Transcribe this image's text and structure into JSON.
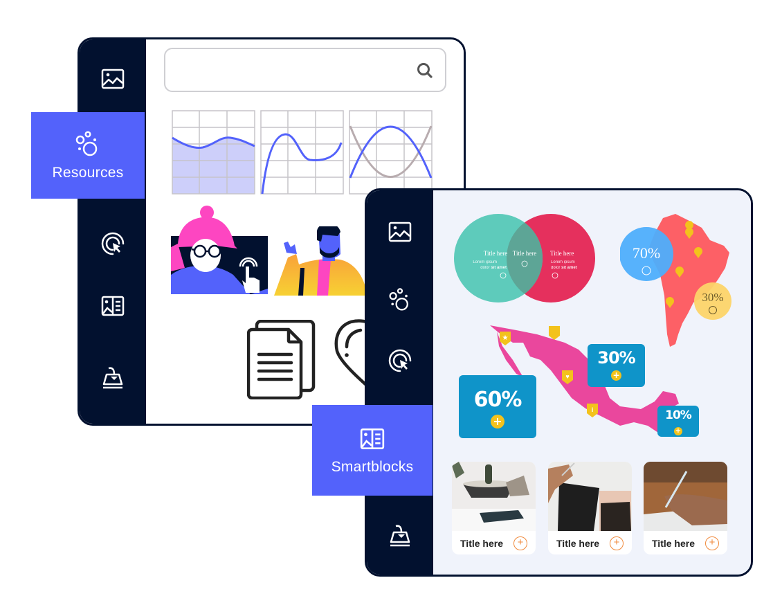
{
  "back_window": {
    "search": {
      "value": "",
      "placeholder": "",
      "icon": "search-icon"
    },
    "sidebar": [
      {
        "icon": "image-icon",
        "label": ""
      },
      {
        "icon": "resources-icon",
        "label": "Resources",
        "active": true
      },
      {
        "icon": "interactive-icon",
        "label": ""
      },
      {
        "icon": "smartblocks-icon",
        "label": ""
      },
      {
        "icon": "import-icon",
        "label": ""
      }
    ],
    "charts": [
      {
        "type": "area",
        "icon": "area-chart-icon"
      },
      {
        "type": "line",
        "icon": "curve-chart-icon"
      },
      {
        "type": "parabola",
        "icon": "parabola-chart-icon"
      }
    ],
    "illustrations": [
      "woman-touch-illustration",
      "man-waving-illustration"
    ],
    "icons": [
      "documents-icon",
      "heart-icon"
    ]
  },
  "front_window": {
    "sidebar": [
      {
        "icon": "image-icon",
        "label": ""
      },
      {
        "icon": "resources-icon",
        "label": ""
      },
      {
        "icon": "interactive-icon",
        "label": ""
      },
      {
        "icon": "smartblocks-icon",
        "label": "Smartblocks",
        "active": true
      },
      {
        "icon": "import-icon",
        "label": ""
      }
    ],
    "venn": {
      "left": {
        "title": "Title here",
        "text_1": "Lorem ipsum",
        "text_2": "dolor ",
        "text_bold": "sit amet",
        "color": "#5ecbbb"
      },
      "middle": {
        "title": "Title here"
      },
      "right": {
        "title": "Title here",
        "text_1": "Lorem ipsum",
        "text_2": "dolor ",
        "text_bold": "sit amet",
        "color": "#e5305d"
      }
    },
    "south_america": {
      "map_color": "#fd6066",
      "bubble_blue": {
        "value": "70%",
        "color": "#4eaefc"
      },
      "bubble_yellow": {
        "value": "30%",
        "color": "#fcd469"
      }
    },
    "mexico": {
      "map_color": "#ea479d",
      "boxes": [
        {
          "value": "60%"
        },
        {
          "value": "30%"
        },
        {
          "value": "10%"
        }
      ],
      "box_color": "#0f94c9"
    },
    "cards": [
      {
        "title": "Title here",
        "image": "plant-desk-photo"
      },
      {
        "title": "Title here",
        "image": "notebook-photo"
      },
      {
        "title": "Title here",
        "image": "writing-photo"
      }
    ]
  },
  "colors": {
    "sidebar": "#02112f",
    "accent": "#5362fb",
    "panel": "#f0f3fb"
  }
}
